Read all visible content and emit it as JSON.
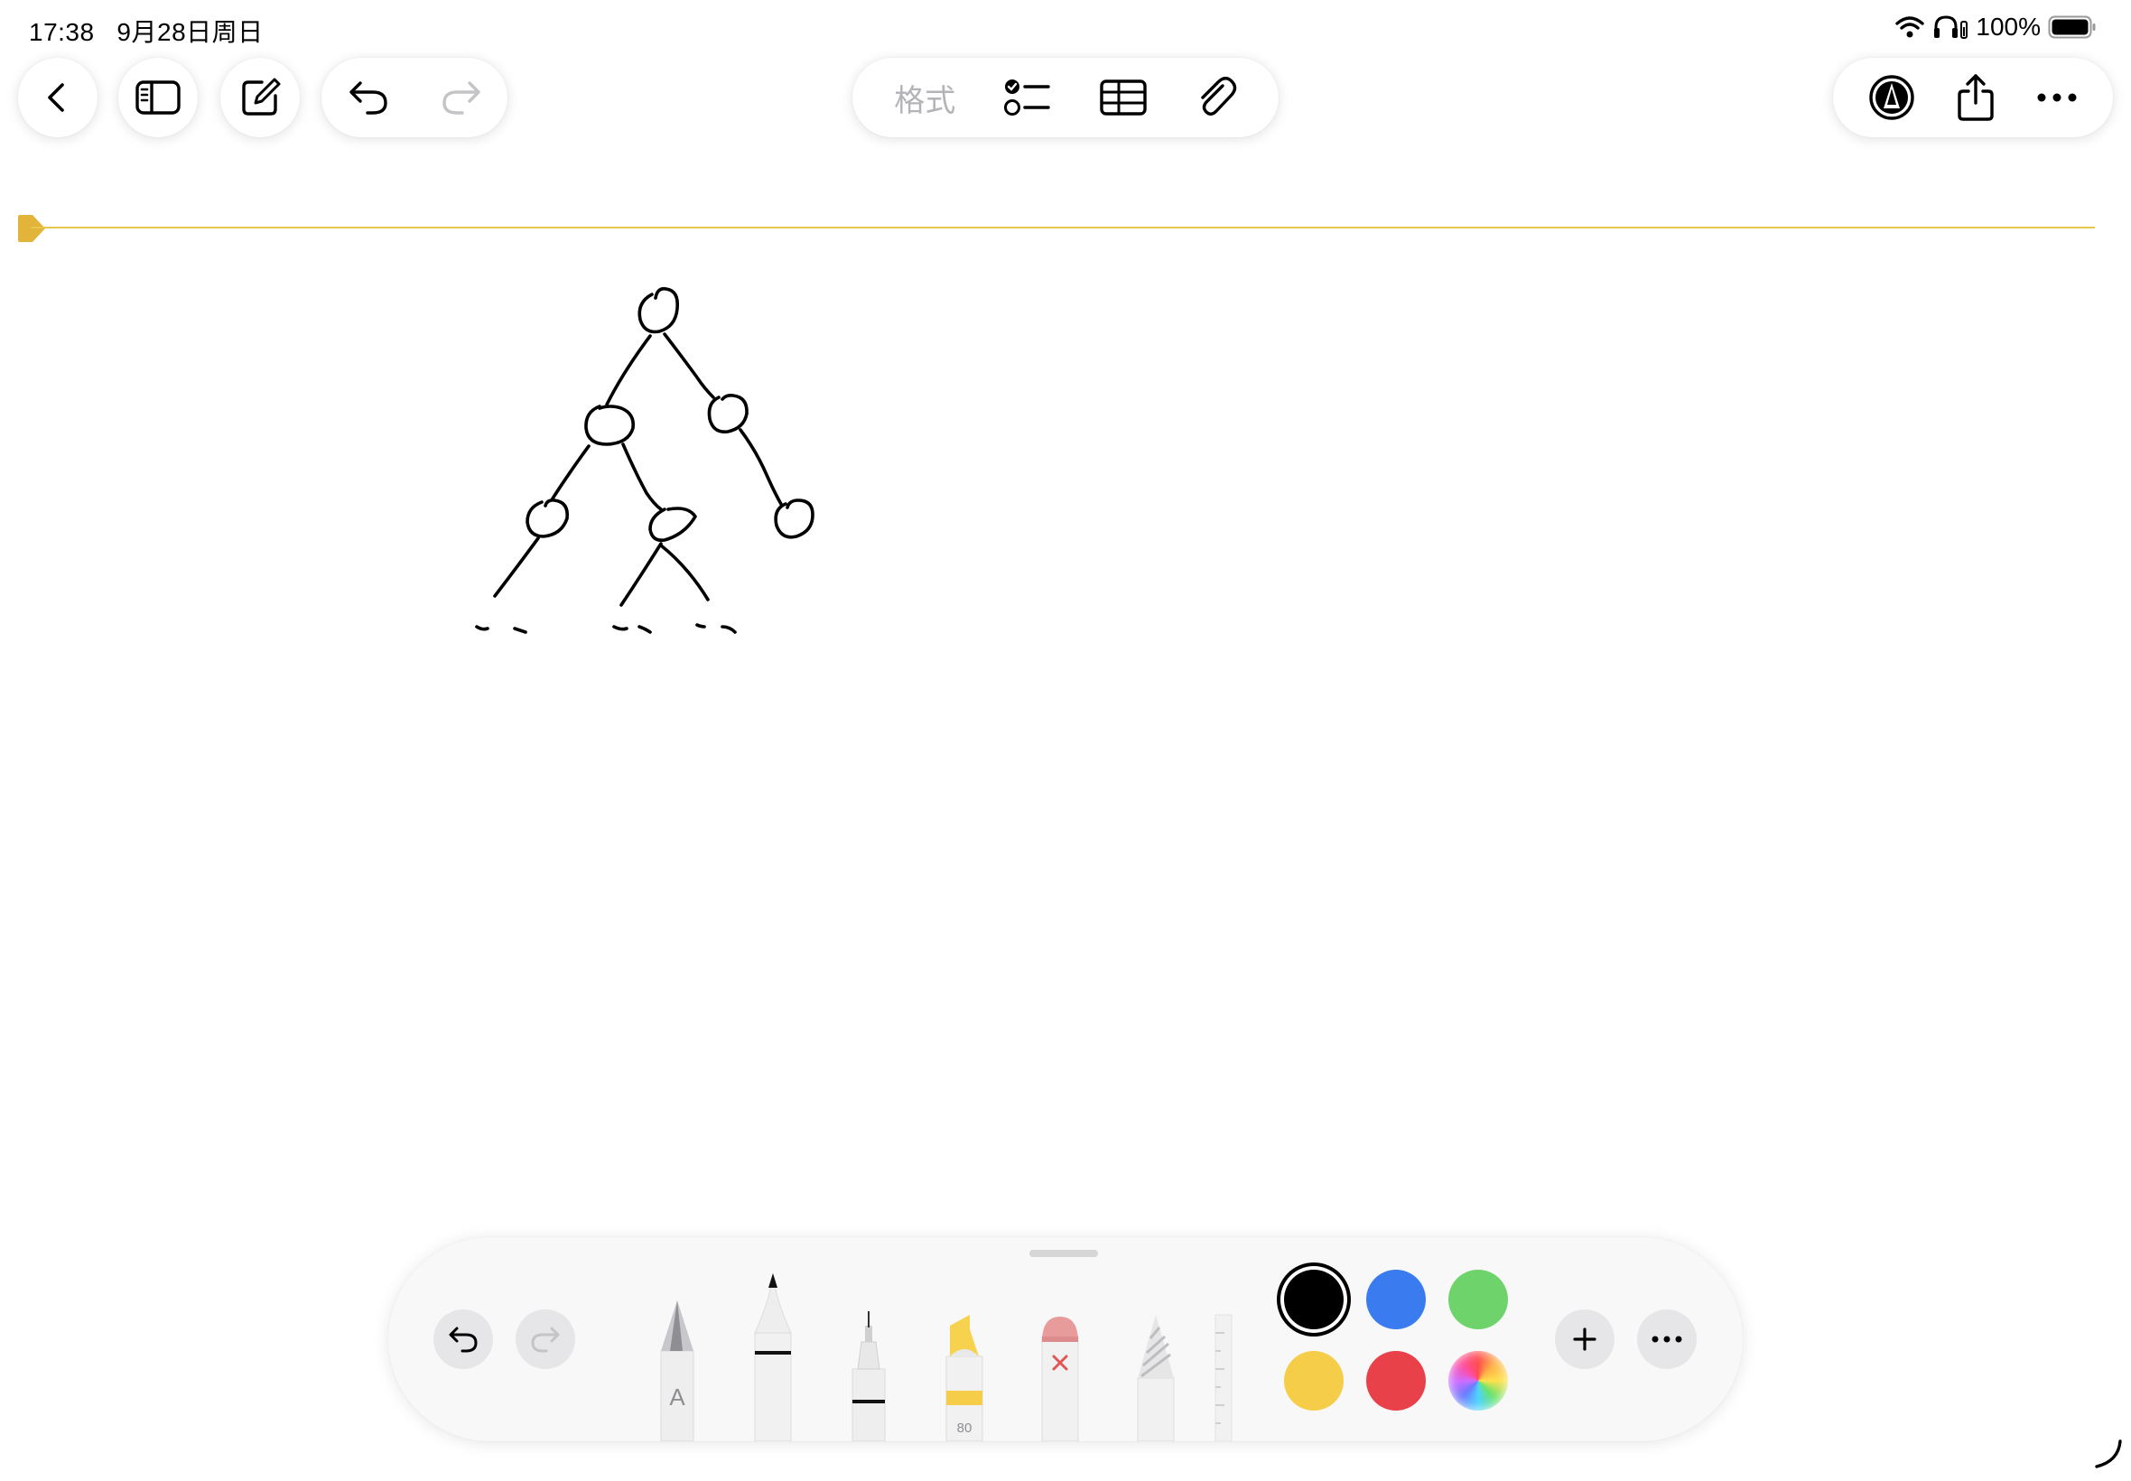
{
  "status_bar": {
    "time": "17:38",
    "date": "9月28日周日",
    "battery_percent": "100%",
    "icons": [
      "wifi-icon",
      "headphones-icon",
      "battery-icon"
    ]
  },
  "toolbar": {
    "left_buttons": [
      "back-chevron-icon",
      "sidebar-icon",
      "compose-icon",
      "undo-icon",
      "redo-icon"
    ],
    "format_label": "格式",
    "center_icons": [
      "checklist-icon",
      "table-icon",
      "paperclip-icon"
    ],
    "right_icons": [
      "markup-pen-icon",
      "share-icon",
      "more-ellipsis-icon"
    ]
  },
  "canvas": {
    "drawing": "hand-drawn binary tree sketch",
    "margin_line_color": "#e8c54b"
  },
  "tool_palette": {
    "tools": [
      "monoline-pen",
      "fountain-pen",
      "fineliner",
      "highlighter",
      "eraser",
      "pencil",
      "ruler"
    ],
    "highlighter_label": "80",
    "pen_letter": "A",
    "colors": [
      "#000000",
      "#3a7cf0",
      "#6fd36b",
      "#f6cd48",
      "#e9414a",
      "multicolor"
    ],
    "selected_color": "#000000",
    "buttons": [
      "palette-undo-icon",
      "palette-redo-icon",
      "add-icon",
      "palette-more-icon"
    ]
  }
}
